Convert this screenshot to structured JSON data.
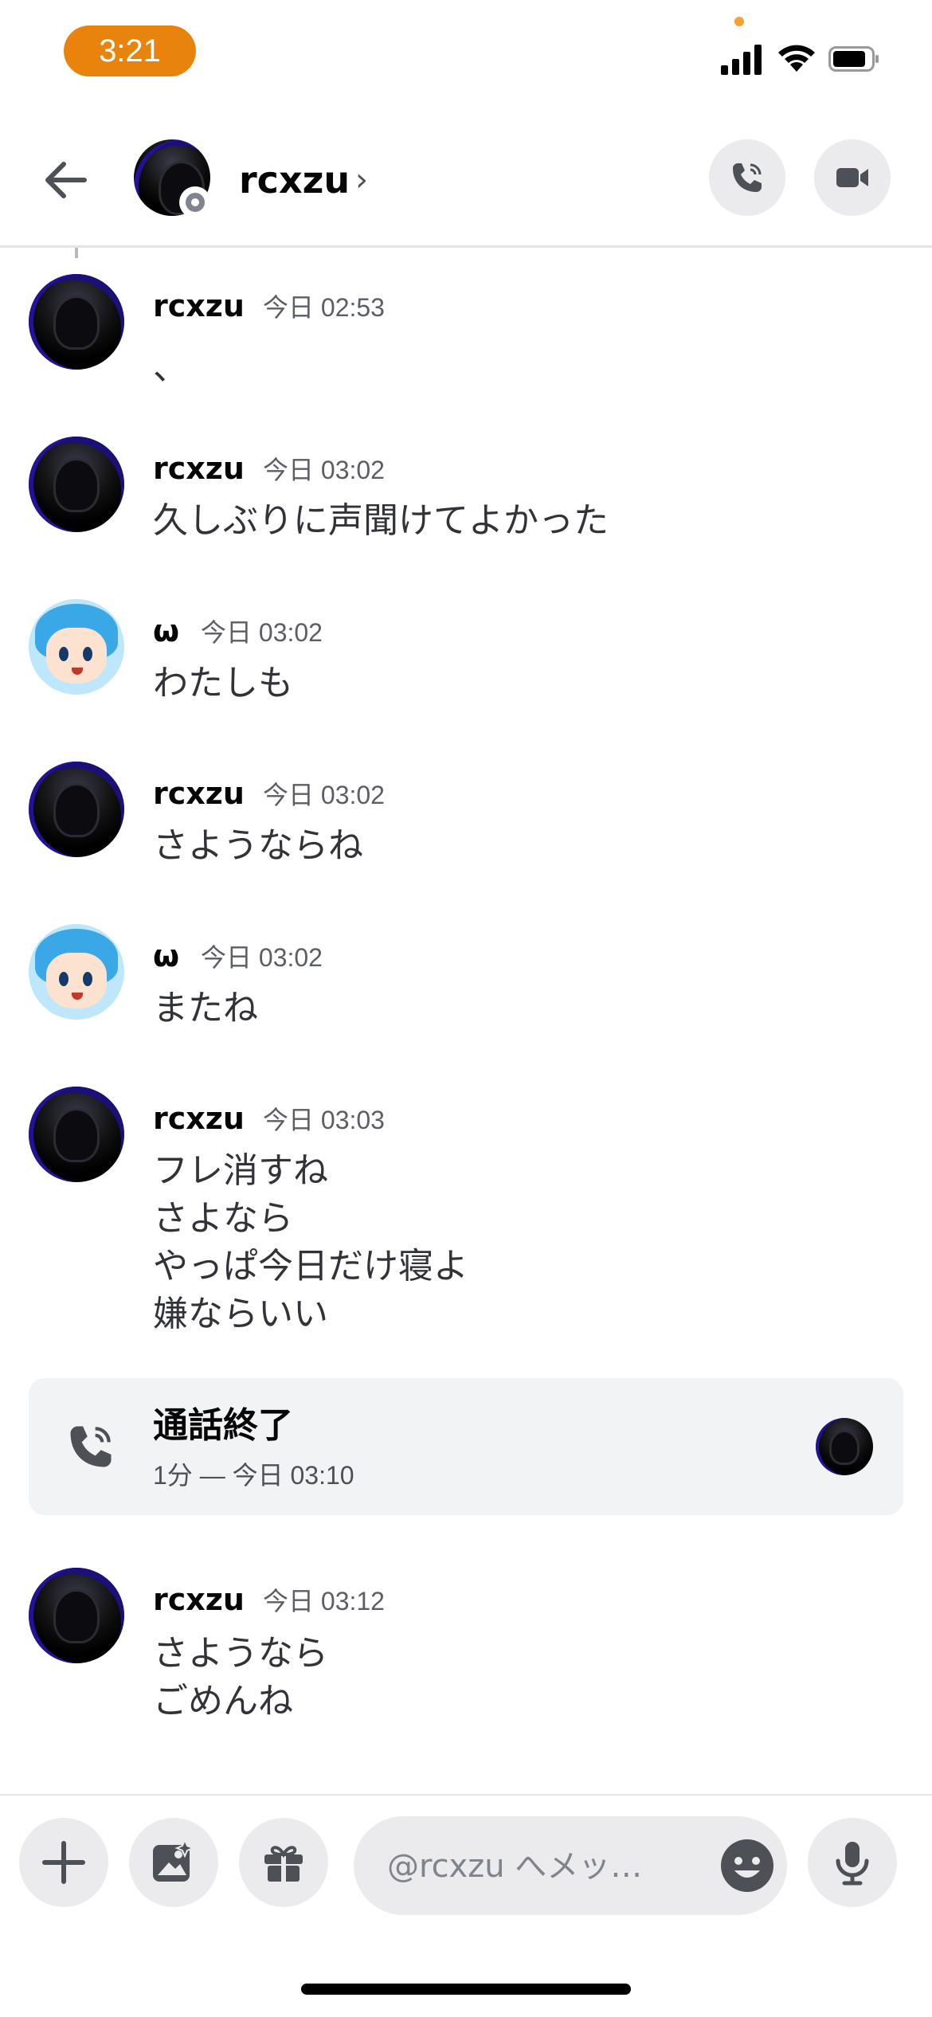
{
  "status_bar": {
    "time": "3:21"
  },
  "header": {
    "name": "rcxzu",
    "chevron": "›",
    "icons": {
      "back": "arrow-left-icon",
      "call": "phone-icon",
      "video": "video-camera-icon"
    }
  },
  "messages": [
    {
      "author": "rcxzu",
      "timestamp": "今日 02:53",
      "lines": [
        "、"
      ],
      "avatar": "dark"
    },
    {
      "author": "rcxzu",
      "timestamp": "今日 03:02",
      "lines": [
        "久しぶりに声聞けてよかった"
      ],
      "avatar": "dark"
    },
    {
      "author": "ω",
      "timestamp": "今日 03:02",
      "lines": [
        "わたしも"
      ],
      "avatar": "blue"
    },
    {
      "author": "rcxzu",
      "timestamp": "今日 03:02",
      "lines": [
        "さようならね"
      ],
      "avatar": "dark"
    },
    {
      "author": "ω",
      "timestamp": "今日 03:02",
      "lines": [
        "またね"
      ],
      "avatar": "blue"
    },
    {
      "author": "rcxzu",
      "timestamp": "今日 03:03",
      "lines": [
        "フレ消すね",
        "さよなら",
        "やっぱ今日だけ寝よ",
        "嫌ならいい"
      ],
      "avatar": "dark"
    }
  ],
  "call_ended": {
    "title": "通話終了",
    "meta": "1分 — 今日 03:10"
  },
  "last_message": {
    "author": "rcxzu",
    "timestamp": "今日 03:12",
    "lines": [
      "さようなら",
      "ごめんね"
    ],
    "avatar": "dark"
  },
  "composer": {
    "placeholder": "@rcxzu へメッ…",
    "icons": [
      "plus-icon",
      "image-icon",
      "gift-icon",
      "emoji-icon",
      "microphone-icon"
    ]
  },
  "colors": {
    "time_pill": "#e8830c",
    "call_card_bg": "#f2f3f5",
    "button_bg": "#ebebed"
  }
}
